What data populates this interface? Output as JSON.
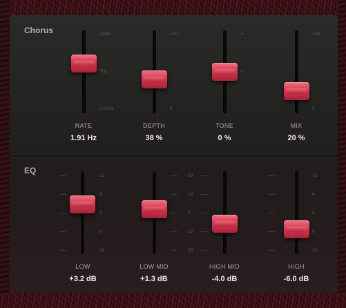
{
  "chorus": {
    "title": "Chorus",
    "sliders": [
      {
        "label": "RATE",
        "value": "1.91 Hz",
        "level": 0.63,
        "scale": [
          "20Hz",
          "1Hz",
          "0.05Hz"
        ]
      },
      {
        "label": "DEPTH",
        "value": "38 %",
        "level": 0.38,
        "scale": [
          "100",
          "",
          "0"
        ]
      },
      {
        "label": "TONE",
        "value": "0 %",
        "level": 0.5,
        "scale": [
          "+",
          "0",
          "-"
        ]
      },
      {
        "label": "MIX",
        "value": "20 %",
        "level": 0.2,
        "scale": [
          "100",
          "",
          "0"
        ]
      }
    ]
  },
  "eq": {
    "title": "EQ",
    "sliders": [
      {
        "label": "LOW",
        "value": "+3.2 dB",
        "level": 0.63,
        "scale": [
          "12",
          "6",
          "0",
          "6",
          "12"
        ]
      },
      {
        "label": "LOW MID",
        "value": "+1.3 dB",
        "level": 0.55,
        "scale": [
          "20",
          "12",
          "0",
          "12",
          "20"
        ]
      },
      {
        "label": "HIGH MID",
        "value": "-4.0 dB",
        "level": 0.33,
        "scale": [
          "",
          "",
          "",
          "",
          ""
        ]
      },
      {
        "label": "HIGH",
        "value": "-6.0 dB",
        "level": 0.25,
        "scale": [
          "12",
          "6",
          "0",
          "6",
          "12"
        ]
      }
    ]
  },
  "colors": {
    "accent": "#e04a5e",
    "panel": "#262524",
    "text": "#f1eeea"
  }
}
